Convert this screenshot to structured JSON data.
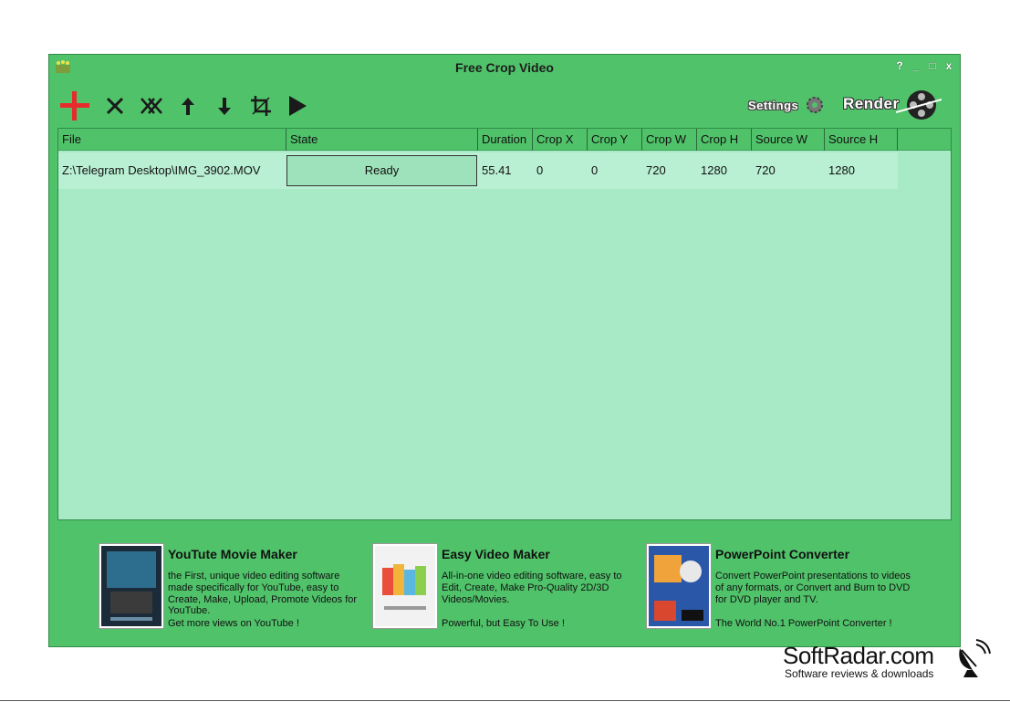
{
  "window": {
    "title": "Free Crop Video",
    "controls": {
      "help": "?",
      "minimize": "_",
      "maximize": "□",
      "close": "x"
    }
  },
  "toolbar": {
    "icons": [
      "add-icon",
      "remove-icon",
      "remove-all-icon",
      "move-up-icon",
      "move-down-icon",
      "crop-icon",
      "play-icon"
    ],
    "settings_label": "Settings",
    "render_label": "Render"
  },
  "table": {
    "columns": [
      "File",
      "State",
      "Duration",
      "Crop X",
      "Crop Y",
      "Crop W",
      "Crop H",
      "Source W",
      "Source H"
    ],
    "rows": [
      {
        "file": "Z:\\Telegram Desktop\\IMG_3902.MOV",
        "state": "Ready",
        "duration": "55.41",
        "crop_x": "0",
        "crop_y": "0",
        "crop_w": "720",
        "crop_h": "1280",
        "source_w": "720",
        "source_h": "1280"
      }
    ]
  },
  "promos": [
    {
      "title": "YouTute Movie Maker",
      "description": "the First, unique video editing software made specifically for YouTube, easy to Create, Make, Upload, Promote Videos for YouTube.",
      "tagline": "Get more views on YouTube !"
    },
    {
      "title": "Easy Video Maker",
      "description": "All-in-one video editing software, easy to Edit, Create, Make Pro-Quality 2D/3D Videos/Movies.",
      "tagline": "Powerful, but Easy To Use !"
    },
    {
      "title": "PowerPoint Converter",
      "description": "Convert PowerPoint presentations to videos of any formats, or Convert and Burn to DVD for DVD player and TV.",
      "tagline": "The World No.1 PowerPoint Converter !"
    }
  ],
  "watermark": {
    "name": "SoftRadar.com",
    "tagline": "Software reviews & downloads"
  },
  "colors": {
    "window_bg": "#50c26a",
    "list_bg": "#a8eac5",
    "row_bg": "#b9efd2",
    "add_red": "#e52b2b"
  }
}
